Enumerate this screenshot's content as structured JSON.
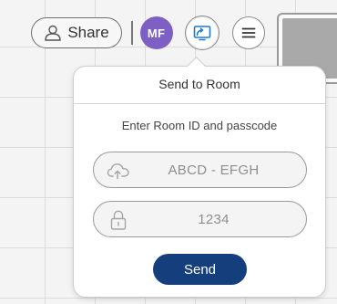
{
  "toolbar": {
    "share_label": "Share",
    "share_icon": "user-icon",
    "avatar_initials": "MF",
    "avatar_color": "#7e5fc4",
    "cast_icon": "cast-screen-icon",
    "cast_icon_color": "#1f78c8",
    "menu_icon": "hamburger-menu-icon"
  },
  "popover": {
    "title": "Send to Room",
    "instruction": "Enter Room ID and passcode",
    "room_field": {
      "icon": "cloud-upload-icon",
      "placeholder": "ABCD - EFGH",
      "value": ""
    },
    "passcode_field": {
      "icon": "lock-icon",
      "placeholder": "1234",
      "value": ""
    },
    "send_label": "Send",
    "send_color": "#153f7c"
  }
}
